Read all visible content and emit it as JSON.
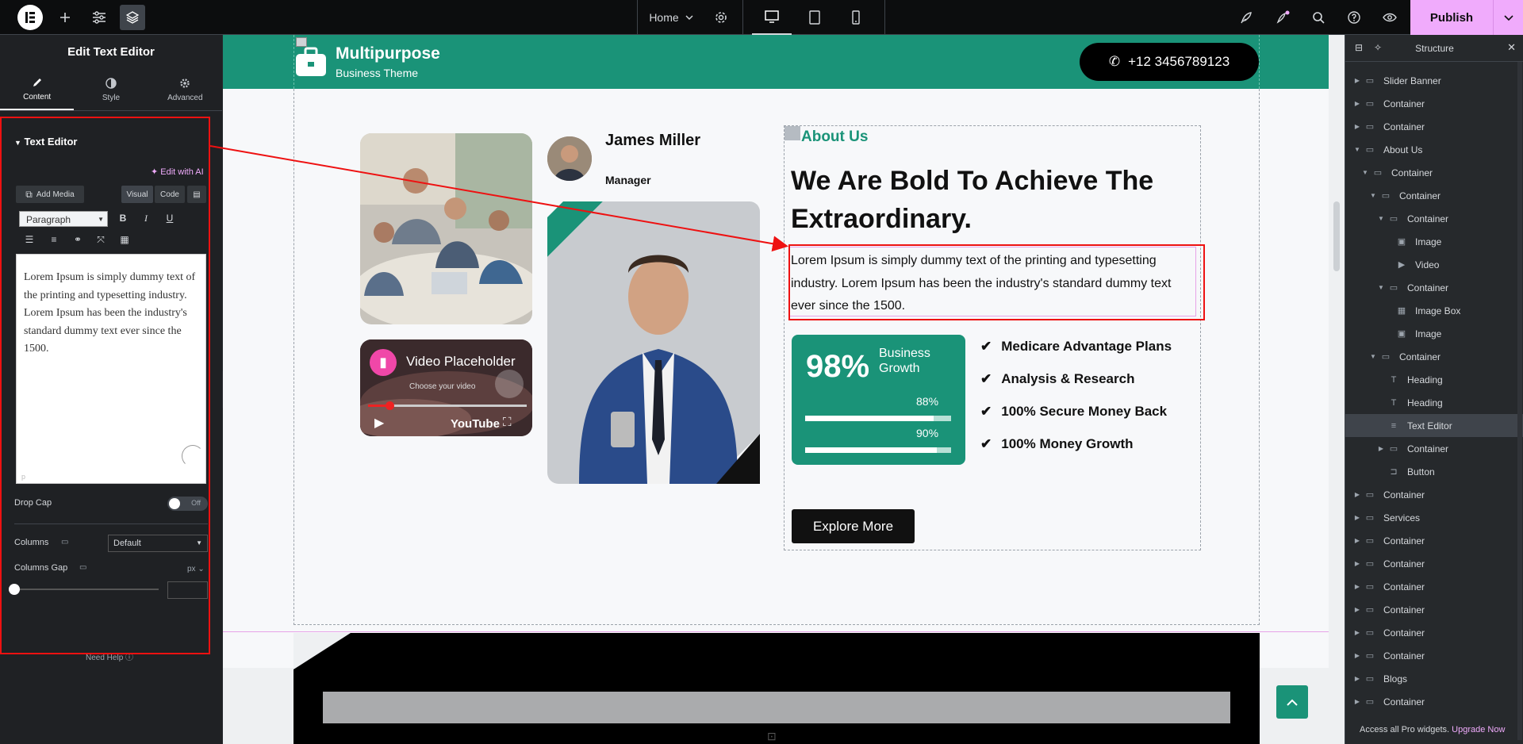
{
  "topbar": {
    "page_name": "Home",
    "publish_label": "Publish"
  },
  "left_panel": {
    "title": "Edit Text Editor",
    "tabs": [
      {
        "label": "Content",
        "icon": "pencil-icon"
      },
      {
        "label": "Style",
        "icon": "half-circle-icon"
      },
      {
        "label": "Advanced",
        "icon": "gear-icon"
      }
    ],
    "section_title": "Text Editor",
    "edit_ai_label": "Edit with AI",
    "add_media_label": "Add Media",
    "visual_tab": "Visual",
    "code_tab": "Code",
    "format_select": "Paragraph",
    "editor_text": "Lorem Ipsum is simply dummy text of the printing and typesetting industry. Lorem Ipsum has been the industry's standard dummy text ever since the 1500.",
    "editor_footer": "p",
    "drop_cap_label": "Drop Cap",
    "drop_cap_toggle": "Off",
    "columns_label": "Columns",
    "columns_value": "Default",
    "columns_gap_label": "Columns Gap",
    "columns_gap_unit": "px",
    "need_help": "Need Help"
  },
  "canvas": {
    "logo_title": "Multipurpose",
    "logo_subtitle": "Business Theme",
    "phone": "+12 3456789123",
    "person_name": "James Miller",
    "person_role": "Manager",
    "video_title": "Video Placeholder",
    "video_subtitle": "Choose your video",
    "video_brand": "YouTube",
    "about_label": "About Us",
    "about_heading": "We Are Bold To Achieve The Extraordinary.",
    "about_paragraph": "Lorem Ipsum is simply dummy text of the printing and typesetting industry. Lorem Ipsum has been the industry's standard dummy text ever since the 1500.",
    "stat_value": "98%",
    "stat_label": "Business Growth",
    "bars": [
      {
        "percent_label": "88%",
        "value": 0.88
      },
      {
        "percent_label": "90%",
        "value": 0.9
      }
    ],
    "checklist": [
      "Medicare Advantage Plans",
      "Analysis & Research",
      "100% Secure Money Back",
      "100% Money Growth"
    ],
    "explore_button": "Explore More"
  },
  "structure": {
    "title": "Structure",
    "items": [
      {
        "label": "Slider Banner",
        "depth": 0,
        "expanded": false,
        "icon": "container-icon"
      },
      {
        "label": "Container",
        "depth": 0,
        "expanded": false,
        "icon": "container-icon"
      },
      {
        "label": "Container",
        "depth": 0,
        "expanded": false,
        "icon": "container-icon"
      },
      {
        "label": "About Us",
        "depth": 0,
        "expanded": true,
        "icon": "container-icon"
      },
      {
        "label": "Container",
        "depth": 1,
        "expanded": true,
        "icon": "container-icon"
      },
      {
        "label": "Container",
        "depth": 2,
        "expanded": true,
        "icon": "container-icon"
      },
      {
        "label": "Container",
        "depth": 3,
        "expanded": true,
        "icon": "container-icon"
      },
      {
        "label": "Image",
        "depth": 4,
        "icon": "image-icon"
      },
      {
        "label": "Video",
        "depth": 4,
        "icon": "video-icon"
      },
      {
        "label": "Container",
        "depth": 3,
        "expanded": true,
        "icon": "container-icon"
      },
      {
        "label": "Image Box",
        "depth": 4,
        "icon": "image-box-icon"
      },
      {
        "label": "Image",
        "depth": 4,
        "icon": "image-icon"
      },
      {
        "label": "Container",
        "depth": 2,
        "expanded": true,
        "icon": "container-icon"
      },
      {
        "label": "Heading",
        "depth": 3,
        "icon": "heading-icon"
      },
      {
        "label": "Heading",
        "depth": 3,
        "icon": "heading-icon"
      },
      {
        "label": "Text Editor",
        "depth": 3,
        "icon": "text-editor-icon",
        "selected": true
      },
      {
        "label": "Container",
        "depth": 3,
        "expanded": false,
        "icon": "container-icon"
      },
      {
        "label": "Button",
        "depth": 3,
        "icon": "button-icon"
      },
      {
        "label": "Container",
        "depth": 0,
        "expanded": false,
        "icon": "container-icon"
      },
      {
        "label": "Services",
        "depth": 0,
        "expanded": false,
        "icon": "container-icon"
      },
      {
        "label": "Container",
        "depth": 0,
        "expanded": false,
        "icon": "container-icon"
      },
      {
        "label": "Container",
        "depth": 0,
        "expanded": false,
        "icon": "container-icon"
      },
      {
        "label": "Container",
        "depth": 0,
        "expanded": false,
        "icon": "container-icon"
      },
      {
        "label": "Container",
        "depth": 0,
        "expanded": false,
        "icon": "container-icon"
      },
      {
        "label": "Container",
        "depth": 0,
        "expanded": false,
        "icon": "container-icon"
      },
      {
        "label": "Container",
        "depth": 0,
        "expanded": false,
        "icon": "container-icon"
      },
      {
        "label": "Blogs",
        "depth": 0,
        "expanded": false,
        "icon": "container-icon"
      },
      {
        "label": "Container",
        "depth": 0,
        "expanded": false,
        "icon": "container-icon"
      }
    ],
    "pro_note": "Access all Pro widgets.",
    "pro_link": "Upgrade Now"
  },
  "colors": {
    "accent": "#f0abfc",
    "brand_green": "#1a9378",
    "highlight_red": "#ee1111"
  }
}
